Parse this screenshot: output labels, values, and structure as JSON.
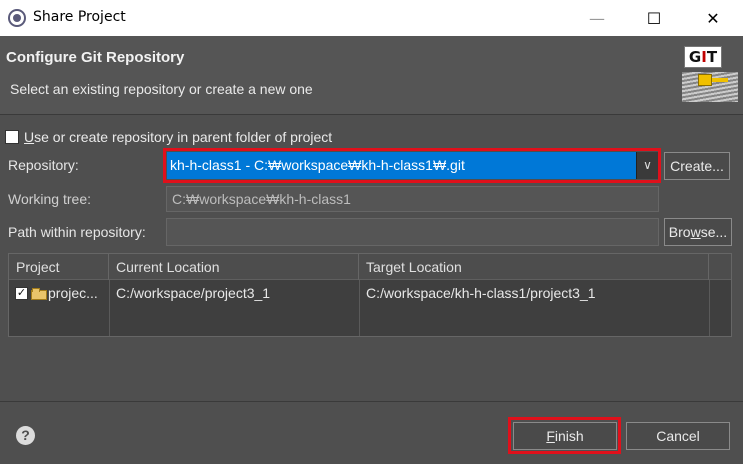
{
  "window": {
    "title": "Share Project",
    "controls": {
      "minimize": "—",
      "maximize": "☐",
      "close": "✕"
    }
  },
  "header": {
    "title": "Configure Git Repository",
    "description": "Select an existing repository or create a new one",
    "logo_text_prefix": "G",
    "logo_text_accent": "I",
    "logo_text_suffix": "T"
  },
  "options": {
    "use_parent_prefix": "U",
    "use_parent_rest": "se or create repository in parent folder of project",
    "use_parent_checked": false
  },
  "form": {
    "repository_label": "Repository:",
    "repository_value": "kh-h-class1 - C:₩workspace₩kh-h-class1₩.git",
    "create_button": "Create...",
    "working_tree_label": "Working tree:",
    "working_tree_value": "C:₩workspace₩kh-h-class1",
    "path_label": "Path within repository:",
    "path_value": "",
    "browse_prefix": "Bro",
    "browse_accent": "w",
    "browse_suffix": "se..."
  },
  "table": {
    "columns": [
      "Project",
      "Current Location",
      "Target Location"
    ],
    "rows": [
      {
        "checked": true,
        "project": "projec...",
        "current": "C:/workspace/project3_1",
        "target": "C:/workspace/kh-h-class1/project3_1"
      }
    ]
  },
  "footer": {
    "help_icon": "?",
    "finish_accent": "F",
    "finish_rest": "inish",
    "cancel_label": "Cancel"
  },
  "colors": {
    "highlight": "#e0101b",
    "selection": "#0078d7",
    "background": "#4f4f4f"
  }
}
